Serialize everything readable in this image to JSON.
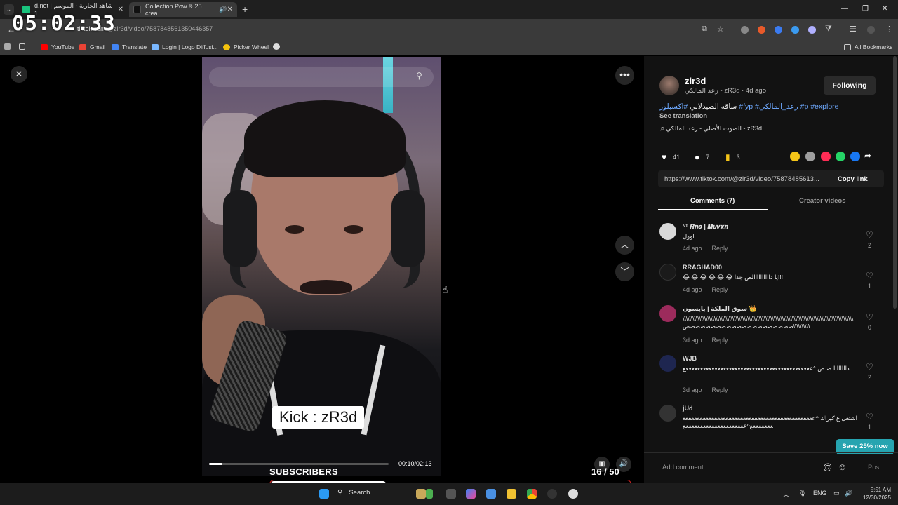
{
  "browser": {
    "tabs": [
      {
        "label": "d.net | شاهد الجارية - الموسم 1",
        "favicon_color": "#19c37d"
      },
      {
        "label": "Collection Pow & 25 crea...",
        "favicon_color": "#111111",
        "active": true
      }
    ],
    "url_prefix": "tiktok.com",
    "url_path": "/@zir3d/video/7587848561350446357",
    "bookmarks": [
      {
        "label": "YouTube",
        "color": "#ff0000"
      },
      {
        "label": "Gmail",
        "color": "#ea4335"
      },
      {
        "label": "Translate",
        "color": "#4285f4"
      },
      {
        "label": "Login | Logo Diffusi...",
        "color": "#7ab8ff"
      },
      {
        "label": "Picker Wheel",
        "color": "#f4c20d"
      }
    ],
    "all_bookmarks_label": "All Bookmarks"
  },
  "overlay": {
    "clock": "05:02:33",
    "subscribers_label": "SUBSCRIBERS",
    "subscribers_count": "16 / 50",
    "subscribers_fraction": 0.32
  },
  "video": {
    "caption_overlay": "Kick : zR3d",
    "time": "00:10/02:13",
    "progress": 0.075
  },
  "author": {
    "username": "zir3d",
    "subtitle": "رعد المالكي - zR3d · 4d ago",
    "follow_label": "Following",
    "caption_text": "ساقه الصيدلاني ",
    "hashtags": [
      "#اكسبلور",
      "#fyp",
      "#رعد_المالكي",
      "#p",
      "#explore"
    ],
    "see_translation": "See translation",
    "sound": "♫  الصوت الأصلي - رعد المالكي - zR3d"
  },
  "stats": {
    "likes": "41",
    "comments": "7",
    "saves": "3"
  },
  "share_colors": [
    "#f5c518",
    "#9e9e9e",
    "#fe2c55",
    "#25d366",
    "#1877f2"
  ],
  "link": {
    "url": "https://www.tiktok.com/@zir3d/video/75878485613...",
    "copy_label": "Copy link"
  },
  "panel_tabs": {
    "comments": "Comments (7)",
    "creator": "Creator videos"
  },
  "comments": [
    {
      "name": "ᴺᵀ 𝑹𝒏𝒐 | 𝑴𝒖𝒗𝒙𝒏",
      "text": "اوول",
      "age": "4d ago",
      "reply": "Reply",
      "likes": "2",
      "avatar_color": "#d9d9d9"
    },
    {
      "name": "RRAGHAD00",
      "text": "😂 😂 😂 😂 😂 😂  يا داااااااااالص جدا!!!",
      "age": "4d ago",
      "reply": "Reply",
      "likes": "1",
      "avatar_color": "#1a1a1a"
    },
    {
      "name": "سوق الملكة | بايسون 👑",
      "text": "\\\\\\\\\\\\\\\\\\\\\\\\\\\\\\\\\\\\\\\\\\\\\\\\\\\\\\\\\\\\\\\\\\\\\\\\\\\\\\\\\\\\\\\\\\\\\\\\\\\\\\\\\\\\\\\\\\\\\\\\\\\\\\\\\\\\\\\\\\\\\\\\\\\\\\\\\\\\\\\\\\\\\\\\\\\\\\\\\\\\\\\\\\\\\\\\\\\\\\\\\\\\\\ صصصصصصصصصصصصصصصصصصصصص\\\\\\\\\\\\\\\\\\\\",
      "age": "3d ago",
      "reply": "Reply",
      "likes": "0",
      "avatar_color": "#9c2b5c"
    },
    {
      "name": "WJB",
      "text": "دااااااااـصـص ^ععععععععععععععععععععععععععععععععععععععععععععع",
      "age": "3d ago",
      "reply": "Reply",
      "likes": "2",
      "avatar_color": "#1e2650"
    },
    {
      "name": "jUd",
      "text": "اشتغل ع كيراك ^عععععععععععععععععععععععععععععععععععععععععععععععععععععع^عععععععععععععععععععععع",
      "age": "",
      "reply": "",
      "likes": "1",
      "avatar_color": "#333333"
    }
  ],
  "save_offer": "Save 25% now",
  "add_comment": {
    "placeholder": "Add comment...",
    "post_label": "Post"
  },
  "taskbar": {
    "search_label": "Search",
    "language": "ENG",
    "time": "5:51 AM",
    "date": "12/30/2025"
  }
}
